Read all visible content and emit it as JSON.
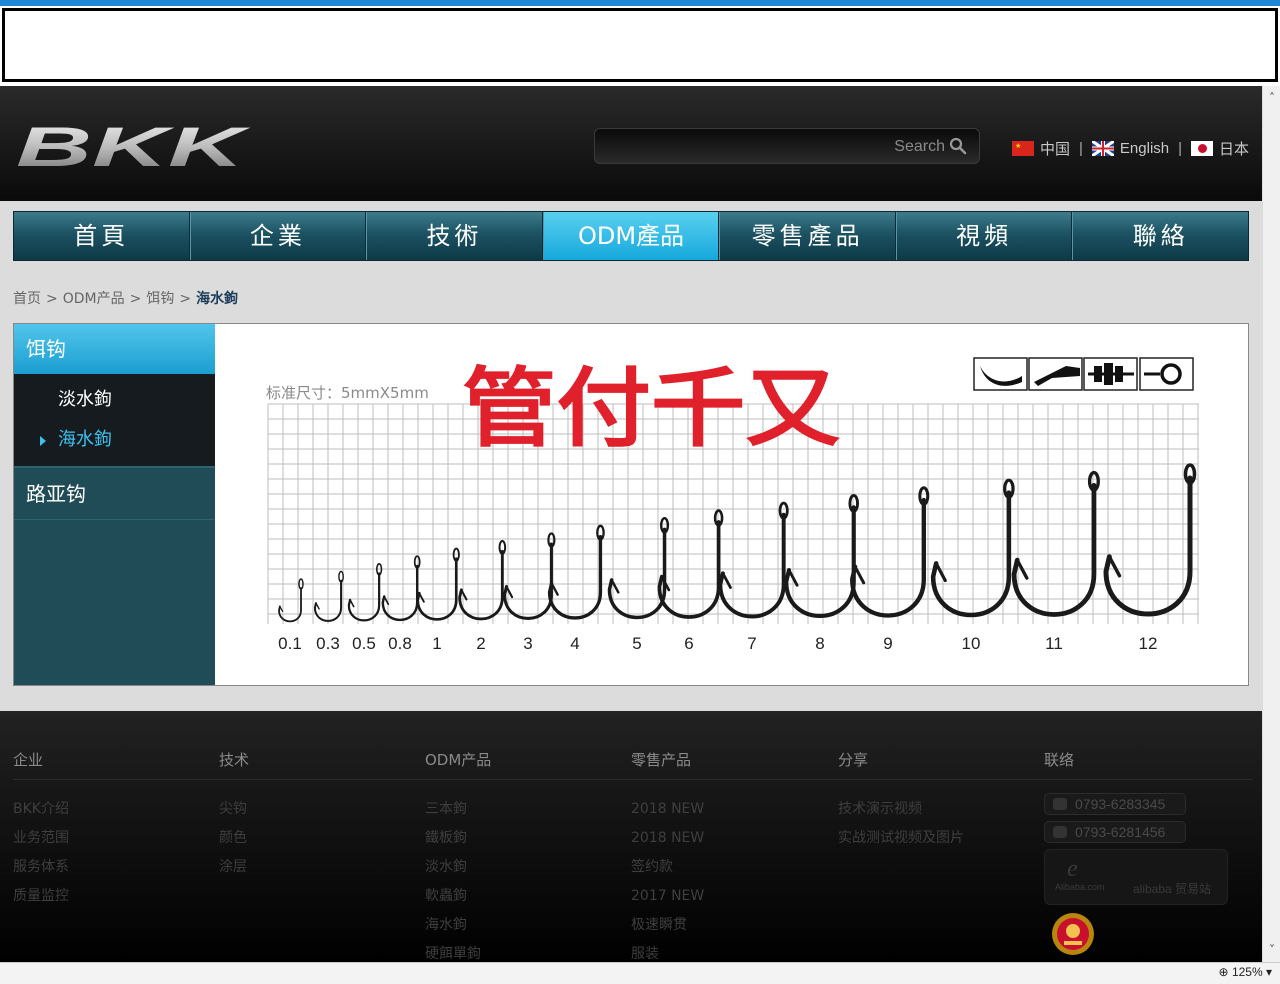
{
  "browser": {
    "zoom": "125%"
  },
  "header": {
    "logo_text": "BKK",
    "search_placeholder": "Search",
    "languages": [
      {
        "label": "中国",
        "flag": "cn-flag-icon"
      },
      {
        "label": "English",
        "flag": "uk-flag-icon"
      },
      {
        "label": "日本",
        "flag": "jp-flag-icon"
      }
    ],
    "lang_sep": "|"
  },
  "nav": {
    "items": [
      "首頁",
      "企業",
      "技術",
      "ODM產品",
      "零售產品",
      "視頻",
      "聯絡"
    ],
    "active_index": 3
  },
  "breadcrumb": {
    "items": [
      "首页",
      "ODM产品",
      "饵钩"
    ],
    "current": "海水鉤",
    "sep": ">"
  },
  "sidebar": {
    "head": "饵钩",
    "sub_items": [
      {
        "label": "淡水鉤",
        "active": false
      },
      {
        "label": "海水鉤",
        "active": true
      }
    ],
    "other": "路亚钩"
  },
  "chart_data": {
    "type": "table",
    "title": "管付千又",
    "scale_note": "标准尺寸：5mmX5mm",
    "sizes": [
      "0.1",
      "0.3",
      "0.5",
      "0.8",
      "1",
      "2",
      "3",
      "4",
      "5",
      "6",
      "7",
      "8",
      "9",
      "10",
      "11",
      "12"
    ],
    "feature_icons": [
      "barbed-point-icon",
      "flat-shank-icon",
      "spade-end-icon",
      "ring-eye-icon"
    ],
    "title_color": "#e0202a"
  },
  "footer": {
    "columns": [
      {
        "heading": "企业",
        "items": [
          "BKK介绍",
          "业务范围",
          "服务体系",
          "质量监控"
        ]
      },
      {
        "heading": "技术",
        "items": [
          "尖钩",
          "颜色",
          "涂层"
        ]
      },
      {
        "heading": "ODM产品",
        "items": [
          "三本鉤",
          "鐵板鉤",
          "淡水鉤",
          "軟蟲鉤",
          "海水鉤",
          "硬餌單鉤"
        ]
      },
      {
        "heading": "零售产品",
        "items": [
          "2018 NEW",
          "2018 NEW",
          "签约款",
          "2017 NEW",
          "极速瞬贯",
          "服装"
        ]
      },
      {
        "heading": "分享",
        "items": [
          "技术演示视频",
          "实战测试视频及图片"
        ]
      },
      {
        "heading": "联络",
        "items": []
      }
    ],
    "phones": [
      "0793-6283345",
      "0793-6281456"
    ],
    "alibaba": {
      "brand": "Alibaba.com",
      "label": "alibaba 贸易站"
    }
  }
}
